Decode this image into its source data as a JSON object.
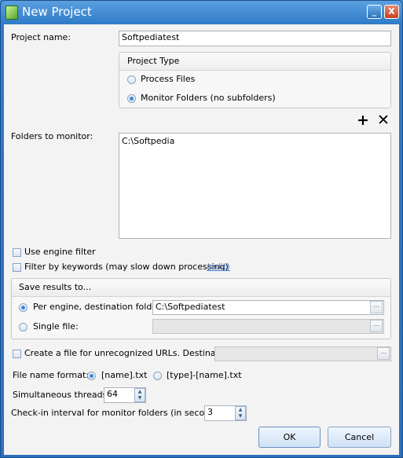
{
  "window": {
    "title": "New Project",
    "minimize_glyph": "_",
    "close_glyph": "X"
  },
  "project": {
    "name_label": "Project name:",
    "name_value": "Softpediatest"
  },
  "project_type": {
    "title": "Project Type",
    "options": [
      {
        "label": "Process Files",
        "selected": false
      },
      {
        "label": "Monitor Folders (no subfolders)",
        "selected": true
      }
    ]
  },
  "folders": {
    "label": "Folders to monitor:",
    "items": [
      "C:\\Softpedia"
    ],
    "add_glyph": "+",
    "remove_glyph": "✕"
  },
  "filters": {
    "engine_filter": {
      "label": "Use engine filter",
      "checked": false
    },
    "keywords": {
      "label": "Filter by keywords (may slow down processing)",
      "checked": false,
      "edit_link": "(edit)"
    }
  },
  "save_results": {
    "title": "Save results to...",
    "per_engine": {
      "label": "Per engine, destination folder:",
      "value": "C:\\Softpediatest",
      "selected": true
    },
    "single_file": {
      "label": "Single file:",
      "value": "",
      "selected": false
    },
    "browse_glyph": "…"
  },
  "unrecognized": {
    "label": "Create a file for unrecognized URLs. Destination:",
    "checked": false,
    "value": ""
  },
  "filename_format": {
    "label": "File name format:",
    "options": [
      {
        "label": "[name].txt",
        "selected": true
      },
      {
        "label": "[type]-[name].txt",
        "selected": false
      }
    ]
  },
  "threads": {
    "label": "Simultaneous threads:",
    "value": "64"
  },
  "checkin": {
    "label": "Check-in interval for monitor folders (in seconds):",
    "value": "3"
  },
  "buttons": {
    "ok": "OK",
    "cancel": "Cancel"
  },
  "spinner": {
    "up": "▲",
    "down": "▼"
  },
  "colors": {
    "titlebar": "#2f7bc8",
    "client": "#f3f3f3",
    "link": "#4a7fd0",
    "radio_dot": "#3a88d6"
  }
}
